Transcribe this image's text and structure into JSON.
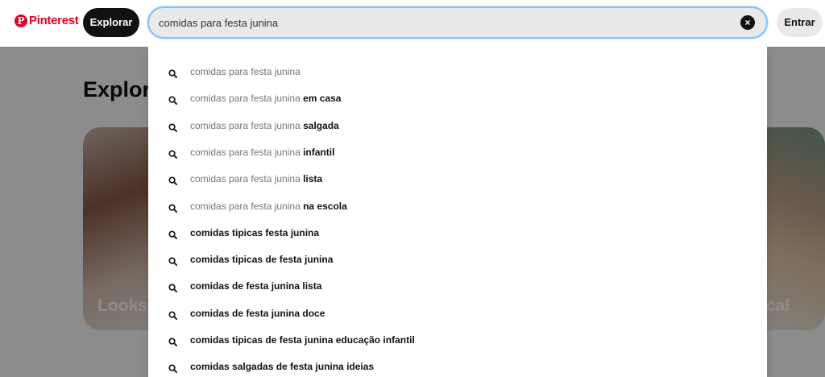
{
  "header": {
    "logo_text": "Pinterest",
    "logo_mark": "P",
    "explore_label": "Explorar",
    "search_value": "comidas para festa junina",
    "clear_icon": "×",
    "login_label": "Entrar",
    "brand_color": "#e60023"
  },
  "page": {
    "title": "Explore",
    "card_left_text": "Looks c",
    "card_right_text": "ical"
  },
  "suggestions": [
    {
      "query": "comidas para festa junina",
      "rest": ""
    },
    {
      "query": "comidas para festa junina",
      "rest": "em casa"
    },
    {
      "query": "comidas para festa junina",
      "rest": "salgada"
    },
    {
      "query": "comidas para festa junina",
      "rest": "infantil"
    },
    {
      "query": "comidas para festa junina",
      "rest": "lista"
    },
    {
      "query": "comidas para festa junina",
      "rest": "na escola"
    },
    {
      "query": "",
      "rest": "comidas tipicas festa junina"
    },
    {
      "query": "",
      "rest": "comidas tipicas de festa junina"
    },
    {
      "query": "",
      "rest": "comidas de festa junina lista"
    },
    {
      "query": "",
      "rest": "comidas de festa junina doce"
    },
    {
      "query": "",
      "rest": "comidas tipicas de festa junina educação infantil"
    },
    {
      "query": "",
      "rest": "comidas salgadas de festa junina ideias"
    }
  ]
}
